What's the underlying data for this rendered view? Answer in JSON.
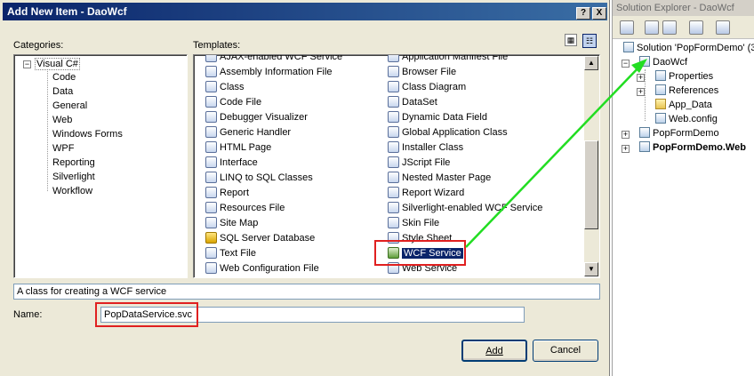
{
  "dialog": {
    "title": "Add New Item - DaoWcf",
    "help_button": "?",
    "close_button": "X",
    "categories_label": "Categories:",
    "templates_label": "Templates:",
    "description": "A class for creating a WCF service",
    "name_label": "Name:",
    "name_value": "PopDataService.svc",
    "add_button": "Add",
    "cancel_button": "Cancel",
    "categories": {
      "root": "Visual C#",
      "children": [
        "Code",
        "Data",
        "General",
        "Web",
        "Windows Forms",
        "WPF",
        "Reporting",
        "Silverlight",
        "Workflow"
      ]
    },
    "templates_left": [
      "AJAX-enabled WCF Service",
      "Assembly Information File",
      "Class",
      "Code File",
      "Debugger Visualizer",
      "Generic Handler",
      "HTML Page",
      "Interface",
      "LINQ to SQL Classes",
      "Report",
      "Resources File",
      "Site Map",
      "SQL Server Database",
      "Text File",
      "Web Configuration File"
    ],
    "templates_right": [
      "Application Manifest File",
      "Browser File",
      "Class Diagram",
      "DataSet",
      "Dynamic Data Field",
      "Global Application Class",
      "Installer Class",
      "JScript File",
      "Nested Master Page",
      "Report Wizard",
      "Silverlight-enabled WCF Service",
      "Skin File",
      "Style Sheet",
      "WCF Service",
      "Web Service"
    ],
    "selected_template": "WCF Service"
  },
  "solution_explorer": {
    "title": "Solution Explorer - DaoWcf",
    "solution": "Solution 'PopFormDemo' (3",
    "project": "DaoWcf",
    "project_items": [
      "Properties",
      "References",
      "App_Data",
      "Web.config"
    ],
    "other_projects": [
      "PopFormDemo",
      "PopFormDemo.Web"
    ]
  },
  "colors": {
    "title_bar": "#0a246a",
    "selection": "#0a246a",
    "highlight_box": "#e02020",
    "arrow": "#22dd22"
  }
}
